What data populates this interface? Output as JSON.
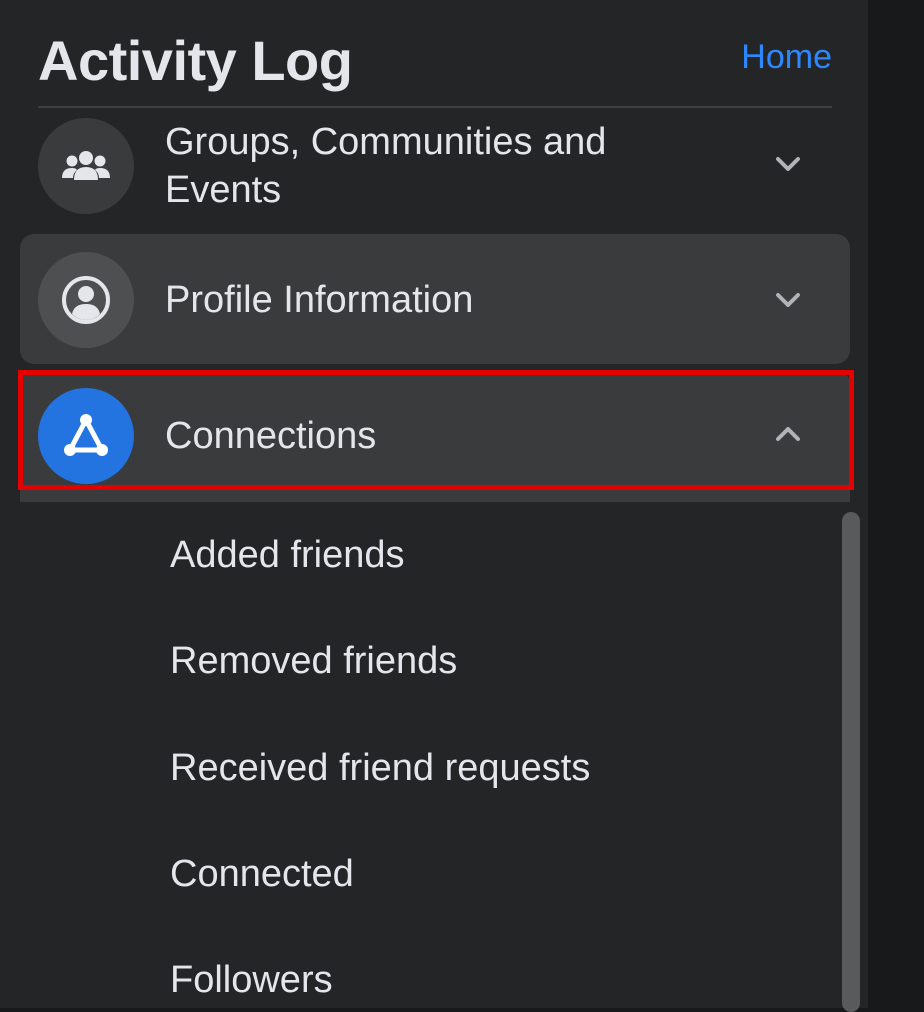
{
  "header": {
    "title": "Activity Log",
    "home_link": "Home"
  },
  "categories": [
    {
      "label": "Groups, Communities and Events",
      "icon": "groups-icon",
      "state": "collapsed"
    },
    {
      "label": "Profile Information",
      "icon": "profile-icon",
      "state": "collapsed"
    },
    {
      "label": "Connections",
      "icon": "connections-icon",
      "state": "expanded"
    }
  ],
  "connections_items": [
    "Added friends",
    "Removed friends",
    "Received friend requests",
    "Connected",
    "Followers"
  ],
  "colors": {
    "background": "#242526",
    "row_hover": "#3a3b3c",
    "accent_blue": "#2374e1",
    "link_blue": "#2d88ff",
    "highlight_red": "#e50000",
    "text": "#e4e6eb"
  }
}
